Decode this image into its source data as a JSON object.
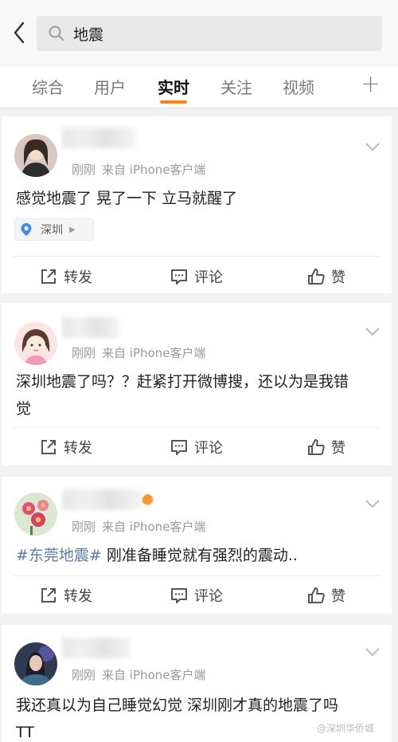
{
  "search": {
    "query": "地震"
  },
  "tabs": [
    "综合",
    "用户",
    "实时",
    "关注",
    "视频"
  ],
  "tab_plus": "+",
  "posts": [
    {
      "time": "刚刚",
      "source": "来自 iPhone客户端",
      "text": "感觉地震了 晃了一下 立马就醒了",
      "location": "深圳"
    },
    {
      "time": "刚刚",
      "source": "来自 iPhone客户端",
      "text_line1": "深圳地震了吗？？赶紧打开微博搜，还以为是我错",
      "text_line2": "觉"
    },
    {
      "time": "刚刚",
      "source": "来自 iPhone客户端",
      "hashtag": "#东莞地震#",
      "text": " 刚准备睡觉就有强烈的震动.."
    },
    {
      "time": "刚刚",
      "source": "来自 iPhone客户端",
      "text_line1": "我还真以为自己睡觉幻觉 深圳刚才真的地震了吗",
      "text_line2": "TT"
    }
  ],
  "actions": {
    "repost": "转发",
    "comment": "评论",
    "like": "赞"
  },
  "watermark": "@深圳华侨城"
}
